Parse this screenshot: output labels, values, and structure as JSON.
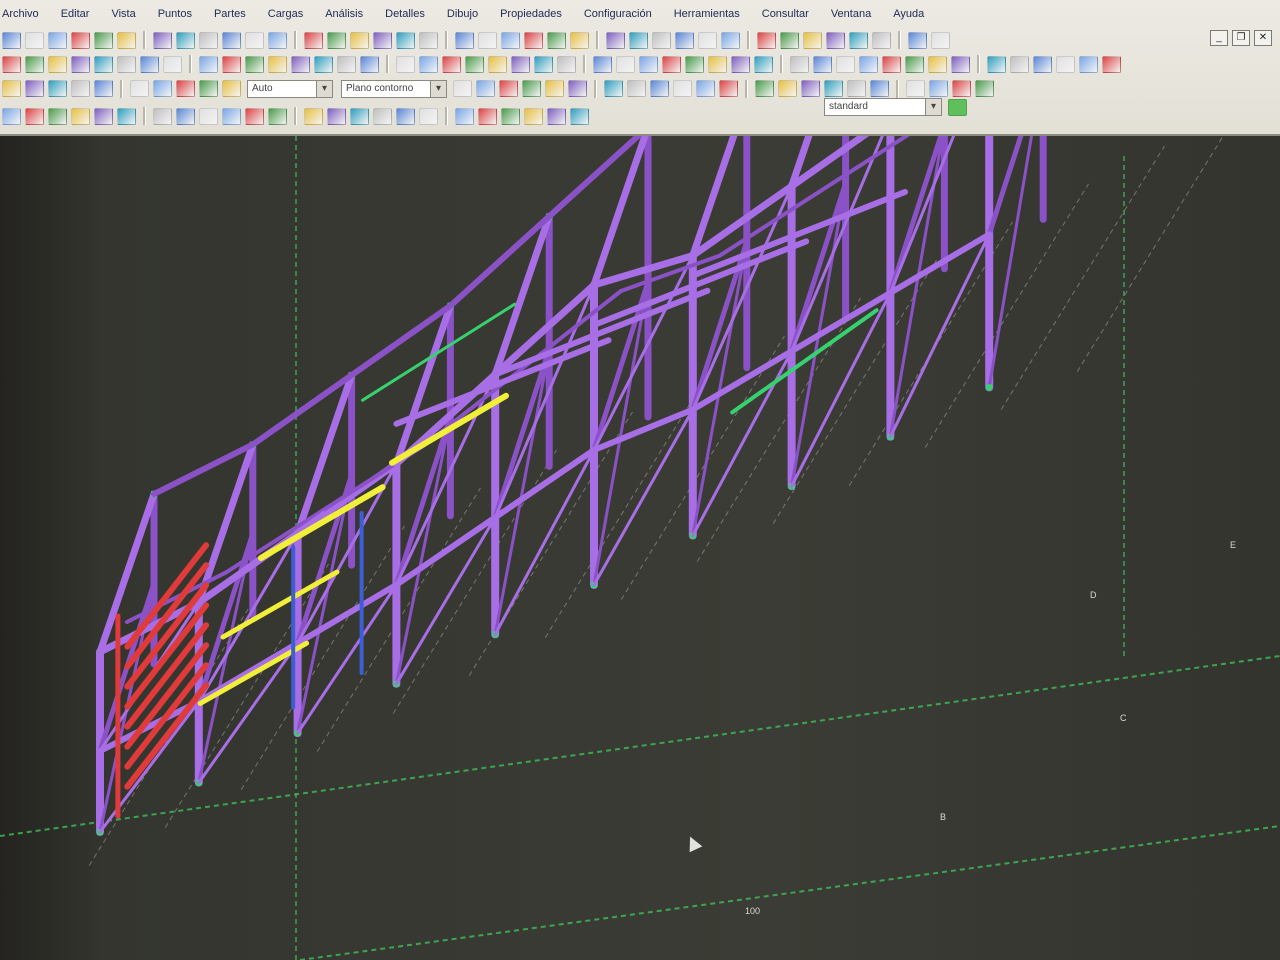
{
  "menu": [
    {
      "label": "Archivo"
    },
    {
      "label": "Editar"
    },
    {
      "label": "Vista"
    },
    {
      "label": "Puntos"
    },
    {
      "label": "Partes"
    },
    {
      "label": "Cargas"
    },
    {
      "label": "Análisis"
    },
    {
      "label": "Detalles"
    },
    {
      "label": "Dibujo"
    },
    {
      "label": "Propiedades"
    },
    {
      "label": "Configuración"
    },
    {
      "label": "Herramientas"
    },
    {
      "label": "Consultar"
    },
    {
      "label": "Ventana"
    },
    {
      "label": "Ayuda"
    }
  ],
  "window_controls": {
    "minimize": "_",
    "restore": "❐",
    "close": "✕"
  },
  "toolbar": {
    "snap_combo": "Auto",
    "plane_combo": "Plano contorno",
    "filter_combo": "standard"
  },
  "viewport": {
    "grid_labels": [
      "100",
      "B",
      "C",
      "D",
      "E"
    ]
  },
  "colors": {
    "beam": "#a86ee6",
    "beam_dark": "#8b52c8",
    "stair": "#e13a3a",
    "highlight": "#f1ef38",
    "node": "#37d26f",
    "column_blue": "#3d5fd6",
    "grid": "#3fbf5c"
  }
}
